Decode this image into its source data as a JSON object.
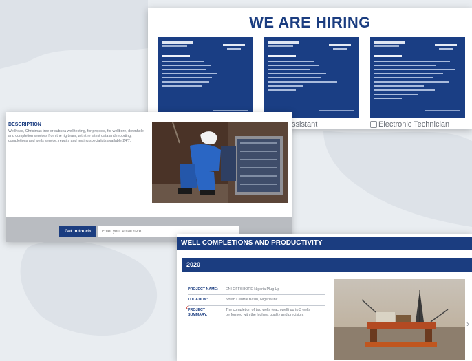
{
  "hiring": {
    "title": "WE ARE HIRING",
    "jobs": [
      {
        "label": ""
      },
      {
        "label": "ssistant"
      },
      {
        "label": "Electronic Technician"
      }
    ]
  },
  "description": {
    "title": "DESCRIPTION",
    "text": "Wellhead, Christmas tree or subsea well testing, for projects, for wellbore, downhole and completion services from the rig team, with the latest data and reporting, completions and wells service, repairs and testing specialists available 24/7.",
    "get_in_touch_label": "Get in touch",
    "email_placeholder": "Enter your email here..."
  },
  "well": {
    "section_title": "WELL COMPLETIONS AND PRODUCTIVITY",
    "year": "2020",
    "project": [
      {
        "key": "PROJECT NAME:",
        "value": "ENI OFFSHORE Nigeria Plug Up"
      },
      {
        "key": "LOCATION:",
        "value": "South Central Basin, Nigeria Inc."
      },
      {
        "key": "PROJECT SUMMARY:",
        "value": "The completion of two wells (each well) up to 3 wells performed with the highest quality and precision."
      }
    ],
    "prev_icon": "chevron-left-icon",
    "next_icon": "chevron-right-icon"
  },
  "colors": {
    "brand_blue": "#1b3d80",
    "accent_red": "#c9352c"
  }
}
